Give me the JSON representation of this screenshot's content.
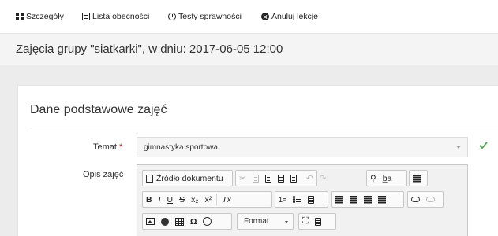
{
  "nav": {
    "items": [
      {
        "label": "Szczegóły",
        "icon": "grid-icon"
      },
      {
        "label": "Lista obecności",
        "icon": "list-icon"
      },
      {
        "label": "Testy sprawności",
        "icon": "clock-icon"
      },
      {
        "label": "Anuluj lekcje",
        "icon": "cancel-circle-icon"
      }
    ]
  },
  "header": {
    "title": "Zajęcia grupy \"siatkarki\", w dniu: 2017-06-05 12:00"
  },
  "card": {
    "title": "Dane podstawowe zajęć"
  },
  "form": {
    "topic_label": "Temat",
    "required_marker": "*",
    "topic_value": "gimnastyka sportowa",
    "description_label": "Opis zajęć"
  },
  "editor": {
    "source_label": "Źródło dokumentu",
    "format_label": "Format",
    "bold": "B",
    "italic": "I",
    "underline": "U",
    "strike": "S",
    "subscript": "x₂",
    "superscript": "x²",
    "clear_format": "Tx",
    "special_char": "Ω",
    "find": "⚲",
    "replace": "b̲a",
    "ordered_list": "1≡",
    "undo": "↶",
    "redo": "↷",
    "cut": "✂"
  },
  "colors": {
    "valid_check": "#4cae4c",
    "required": "#cc0000"
  }
}
